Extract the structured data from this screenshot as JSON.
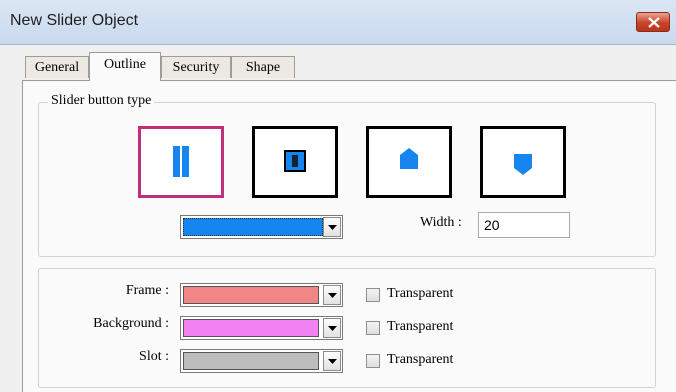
{
  "window": {
    "title": "New Slider Object"
  },
  "tabs": [
    {
      "label": "General"
    },
    {
      "label": "Outline",
      "active": true
    },
    {
      "label": "Security"
    },
    {
      "label": "Shape"
    }
  ],
  "slider_button_type": {
    "group_label": "Slider button type",
    "options": [
      {
        "icon": "double-bar-icon",
        "selected": true
      },
      {
        "icon": "framed-bar-icon"
      },
      {
        "icon": "arrow-up-pentagon-icon"
      },
      {
        "icon": "arrow-down-pentagon-icon"
      }
    ],
    "color": "#1685f0",
    "width_label": "Width :",
    "width_value": "20"
  },
  "colors": {
    "frame": {
      "label": "Frame :",
      "color": "#f28585",
      "transparent_label": "Transparent",
      "transparent": false
    },
    "background": {
      "label": "Background :",
      "color": "#f281f2",
      "transparent_label": "Transparent",
      "transparent": false
    },
    "slot": {
      "label": "Slot :",
      "color": "#bdbdbd",
      "transparent_label": "Transparent",
      "transparent": false
    }
  }
}
